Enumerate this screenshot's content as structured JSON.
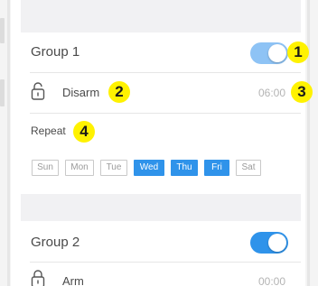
{
  "groups": [
    {
      "title": "Group 1",
      "enabled": true,
      "mode": "Disarm",
      "time": "06:00"
    },
    {
      "title": "Group 2",
      "enabled": true,
      "mode": "Arm",
      "time": "00:00"
    }
  ],
  "repeat": {
    "label": "Repeat",
    "days": [
      {
        "label": "Sun",
        "selected": false
      },
      {
        "label": "Mon",
        "selected": false
      },
      {
        "label": "Tue",
        "selected": false
      },
      {
        "label": "Wed",
        "selected": true
      },
      {
        "label": "Thu",
        "selected": true
      },
      {
        "label": "Fri",
        "selected": true
      },
      {
        "label": "Sat",
        "selected": false
      }
    ]
  },
  "annotations": {
    "badge_1": "1",
    "badge_2": "2",
    "badge_3": "3",
    "badge_4": "4"
  },
  "colors": {
    "accent": "#2f93ea",
    "toggle_on_light": "#8ec3f5",
    "toggle_on": "#2f93ea",
    "badge": "#fff200",
    "time_text": "#b4b4b4"
  },
  "icons": {
    "lock_open": "lock-open-icon",
    "lock_closed": "lock-closed-icon"
  }
}
